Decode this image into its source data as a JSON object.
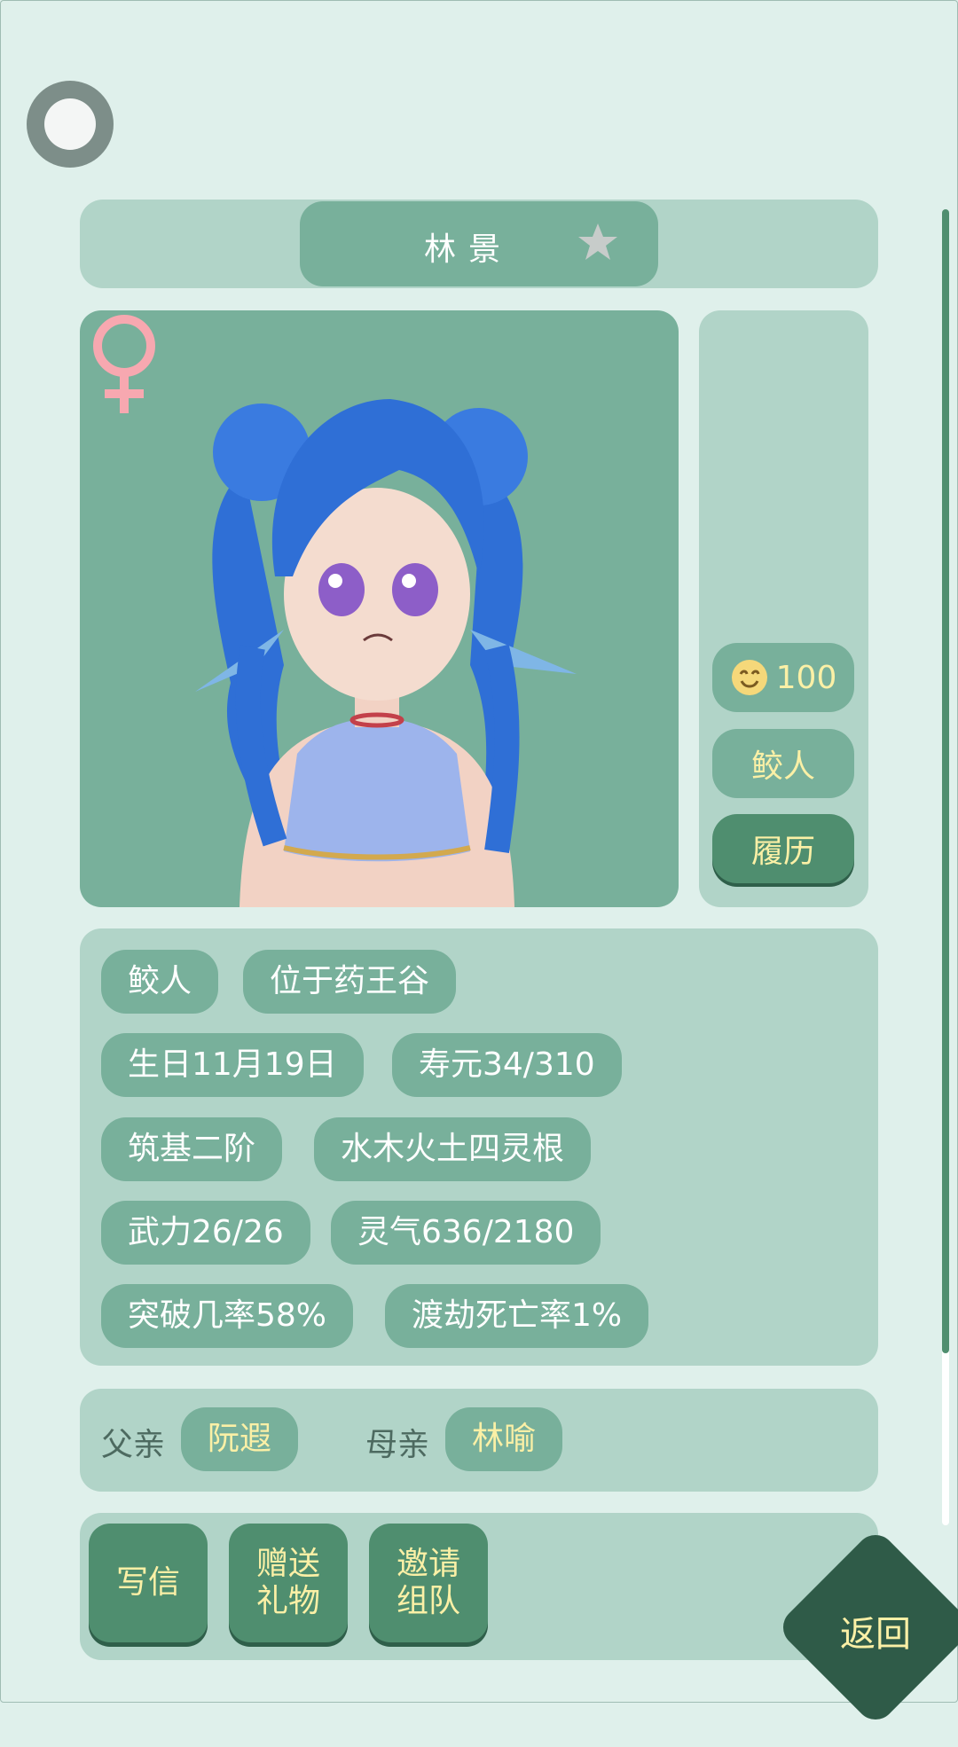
{
  "header": {
    "name": "林景",
    "favorite_icon": "star-icon",
    "toggle_icon": "toggle-icon"
  },
  "portrait": {
    "gender_symbol": "♀",
    "gender_color": "#f7a8b0"
  },
  "side": {
    "mood_value": "100",
    "mood_icon": "smile-face-icon",
    "race": "鲛人",
    "history_label": "履历"
  },
  "info_tags": [
    "鲛人",
    "位于药王谷",
    "生日11月19日",
    "寿元34/310",
    "筑基二阶",
    "水木火土四灵根",
    "武力26/26",
    "灵气636/2180",
    "突破几率58%",
    "渡劫死亡率1%"
  ],
  "family": {
    "father_label": "父亲",
    "father_name": "阮遐",
    "mother_label": "母亲",
    "mother_name": "林喻"
  },
  "actions": {
    "letter": "写信",
    "gift_line1": "赠送",
    "gift_line2": "礼物",
    "team_line1": "邀请",
    "team_line2": "组队"
  },
  "back_label": "返回",
  "colors": {
    "background": "#dff0eb",
    "panel": "#b1d4c8",
    "pill": "#78b09b",
    "button": "#4f8e6f",
    "accent_text": "#fbf0a6",
    "back": "#2f5b48"
  }
}
